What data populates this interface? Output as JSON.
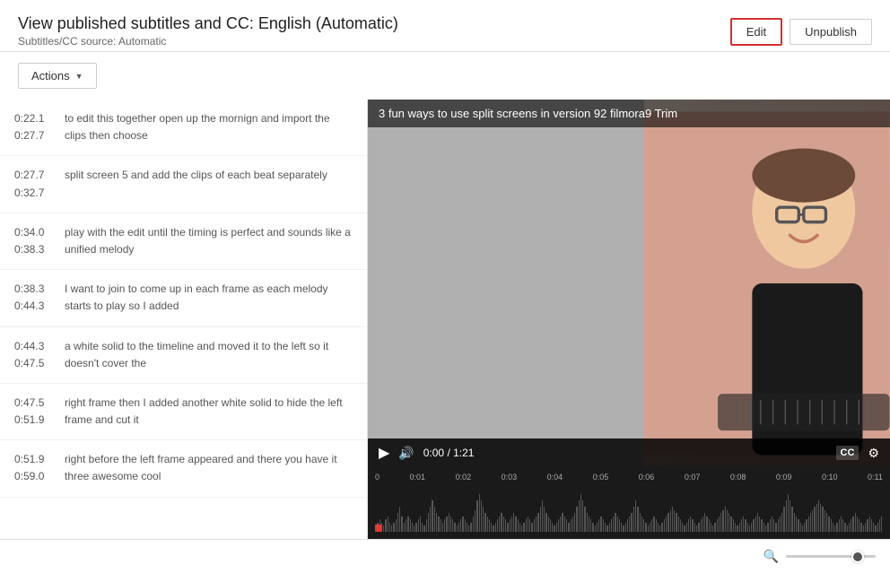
{
  "header": {
    "title": "View published subtitles and CC: English (Automatic)",
    "source_label": "Subtitles/CC source: Automatic",
    "edit_label": "Edit",
    "unpublish_label": "Unpublish"
  },
  "actions_button": "Actions",
  "subtitles": [
    {
      "time_start": "0:22.1",
      "time_end": "0:27.7",
      "text": "to edit this together open up the mornign and import the clips then choose"
    },
    {
      "time_start": "0:27.7",
      "time_end": "0:32.7",
      "text": "split screen 5 and add the clips of each beat separately"
    },
    {
      "time_start": "0:34.0",
      "time_end": "0:38.3",
      "text": "play with the edit until the timing is perfect and sounds like a unified melody"
    },
    {
      "time_start": "0:38.3",
      "time_end": "0:44.3",
      "text": "I want to join to come up in each frame as each melody starts to play so I added"
    },
    {
      "time_start": "0:44.3",
      "time_end": "0:47.5",
      "text": "a white solid to the timeline and moved it to the left so it doesn't cover the"
    },
    {
      "time_start": "0:47.5",
      "time_end": "0:51.9",
      "text": "right frame then I added another white solid to hide the left frame and cut it"
    },
    {
      "time_start": "0:51.9",
      "time_end": "0:59.0",
      "text": "right before the left frame appeared and there you have it three awesome cool"
    }
  ],
  "video": {
    "title": "3 fun ways to use split screens in version 92 filmora9 Trim",
    "time_current": "0:00",
    "time_total": "1:21"
  },
  "timeline": {
    "markers": [
      "0",
      "0:01",
      "0:02",
      "0:03",
      "0:04",
      "0:05",
      "0:06",
      "0:07",
      "0:08",
      "0:09",
      "0:10",
      "0:11"
    ]
  },
  "icons": {
    "play": "▶",
    "volume": "🔊",
    "cc": "CC",
    "gear": "⚙",
    "search": "🔍"
  },
  "zoom": {
    "value": 85
  }
}
